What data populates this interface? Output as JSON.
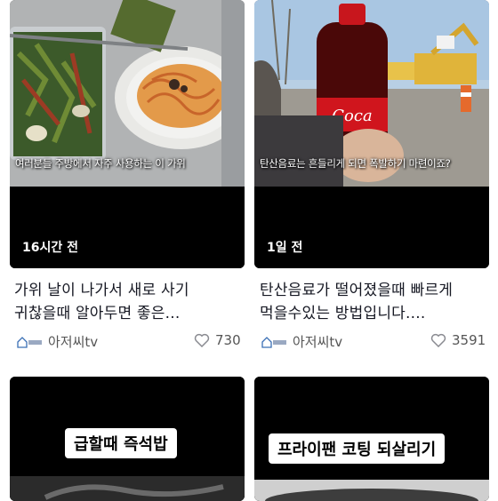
{
  "feed": {
    "cards": [
      {
        "caption": "여러분들 주방에서 자주 사용하는 이 가위",
        "time_ago": "16시간 전",
        "title_line1": "가위 날이 나가서 새로 사기",
        "title_line2": "귀찮을때 알아두면 좋은...",
        "author": "아저씨tv",
        "likes": "730"
      },
      {
        "caption": "탄산음료는 흔들리게 되면 폭발하기 마련이죠?",
        "time_ago": "1일 전",
        "title_line1": "탄산음료가 떨어졌을때 빠르게",
        "title_line2": "먹을수있는 방법입니다....",
        "author": "아저씨tv",
        "likes": "3591"
      },
      {
        "banner": "급할때 즉석밥"
      },
      {
        "banner": "프라이팬 코팅 되살리기"
      }
    ]
  },
  "colors": {
    "heart": "#8a8b91",
    "text": "#161823",
    "muted": "#555555"
  },
  "icons": {
    "like": "heart-icon",
    "channel_avatar": "house-logo-icon"
  }
}
